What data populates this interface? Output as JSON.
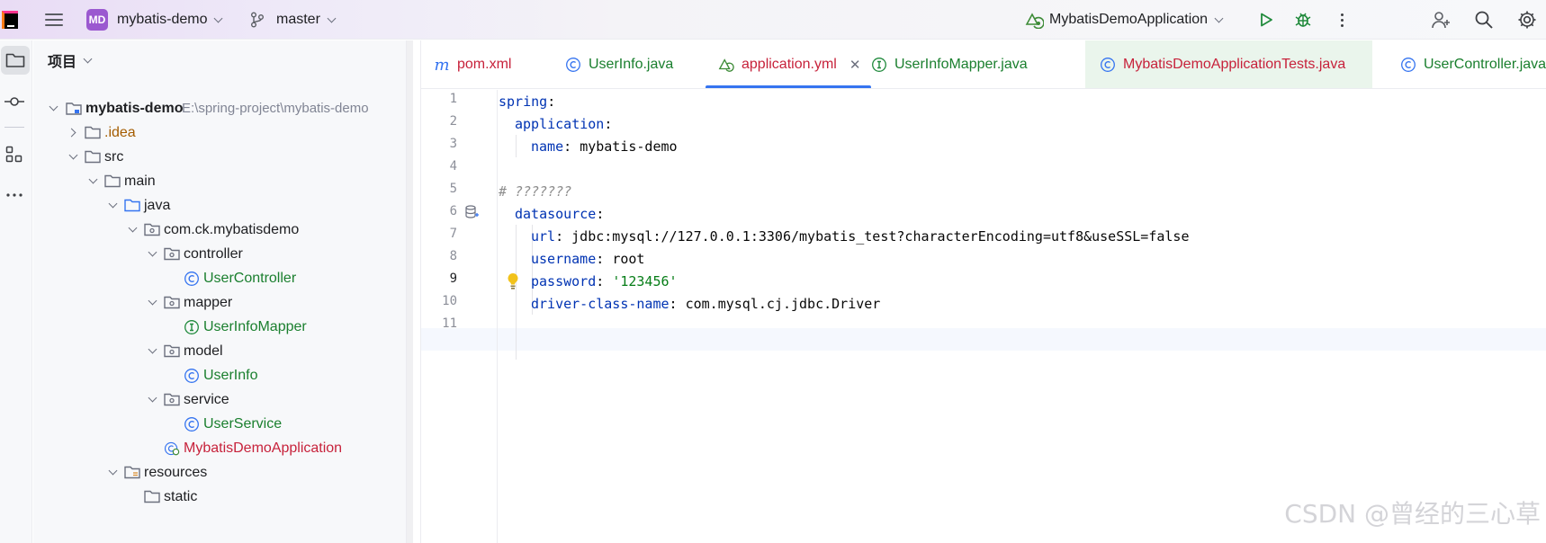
{
  "titlebar": {
    "project_badge": "MD",
    "project_name": "mybatis-demo",
    "branch_name": "master",
    "run_config": "MybatisDemoApplication"
  },
  "project_panel": {
    "title": "项目",
    "root_name": "mybatis-demo",
    "root_path": "E:\\spring-project\\mybatis-demo",
    "items": [
      {
        "label": ".idea"
      },
      {
        "label": "src"
      },
      {
        "label": "main"
      },
      {
        "label": "java"
      },
      {
        "label": "com.ck.mybatisdemo"
      },
      {
        "label": "controller"
      },
      {
        "label": "UserController"
      },
      {
        "label": "mapper"
      },
      {
        "label": "UserInfoMapper"
      },
      {
        "label": "model"
      },
      {
        "label": "UserInfo"
      },
      {
        "label": "service"
      },
      {
        "label": "UserService"
      },
      {
        "label": "MybatisDemoApplication"
      },
      {
        "label": "resources"
      },
      {
        "label": "static"
      }
    ]
  },
  "editor": {
    "tabs": [
      {
        "label": "pom.xml"
      },
      {
        "label": "UserInfo.java"
      },
      {
        "label": "application.yml"
      },
      {
        "label": "UserInfoMapper.java"
      },
      {
        "label": "MybatisDemoApplicationTests.java"
      },
      {
        "label": "UserController.java"
      }
    ],
    "line_numbers": [
      "1",
      "2",
      "3",
      "4",
      "5",
      "6",
      "7",
      "8",
      "9",
      "10",
      "11"
    ],
    "current_line": "9",
    "code": {
      "l1_key": "spring",
      "l2_key": "application",
      "l3_key": "name",
      "l3_val": "mybatis-demo",
      "l5_comment": "# ???????",
      "l6_key": "datasource",
      "l7_key": "url",
      "l7_val": "jdbc:mysql://127.0.0.1:3306/mybatis_test?characterEncoding=utf8&useSSL=false",
      "l8_key": "username",
      "l8_val": "root",
      "l9_key": "password",
      "l9_val": "'123456'",
      "l10_key": "driver-class-name",
      "l10_val": "com.mysql.cj.jdbc.Driver"
    }
  },
  "watermark": "CSDN @曾经的三心草",
  "colors": {
    "accent": "#3574f0",
    "project_badge": "#9b59d0",
    "yaml_key": "#0033b3",
    "yaml_string": "#067d17",
    "tree_green": "#1a7f2e",
    "tree_red": "#c7223b"
  }
}
